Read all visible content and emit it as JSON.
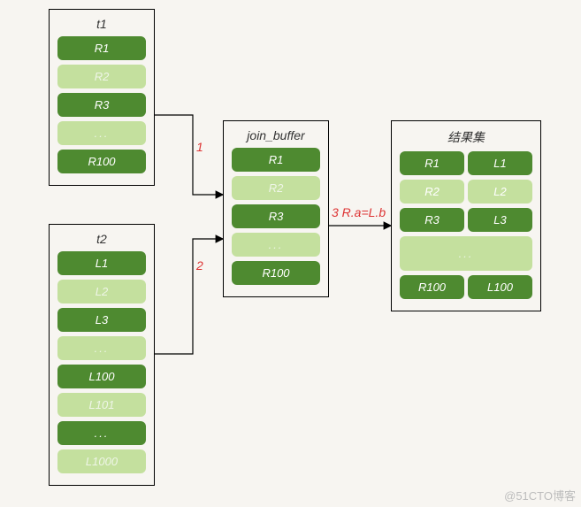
{
  "t1": {
    "title": "t1",
    "rows": [
      {
        "label": "R1",
        "shade": "dark"
      },
      {
        "label": "R2",
        "shade": "light"
      },
      {
        "label": "R3",
        "shade": "dark"
      },
      {
        "label": "...",
        "shade": "light"
      },
      {
        "label": "R100",
        "shade": "dark"
      }
    ]
  },
  "t2": {
    "title": "t2",
    "rows": [
      {
        "label": "L1",
        "shade": "dark"
      },
      {
        "label": "L2",
        "shade": "light"
      },
      {
        "label": "L3",
        "shade": "dark"
      },
      {
        "label": "...",
        "shade": "light"
      },
      {
        "label": "L100",
        "shade": "dark"
      },
      {
        "label": "L101",
        "shade": "light"
      },
      {
        "label": "...",
        "shade": "dark"
      },
      {
        "label": "L1000",
        "shade": "light"
      }
    ]
  },
  "join_buffer": {
    "title": "join_buffer",
    "rows": [
      {
        "label": "R1",
        "shade": "dark"
      },
      {
        "label": "R2",
        "shade": "light"
      },
      {
        "label": "R3",
        "shade": "dark"
      },
      {
        "label": "...",
        "shade": "light"
      },
      {
        "label": "R100",
        "shade": "dark"
      }
    ]
  },
  "result": {
    "title": "结果集",
    "pairs": [
      {
        "l": "R1",
        "r": "L1",
        "shade": "dark"
      },
      {
        "l": "R2",
        "r": "L2",
        "shade": "light"
      },
      {
        "l": "R3",
        "r": "L3",
        "shade": "dark"
      }
    ],
    "mid_ellipsis": "...",
    "last_pair": {
      "l": "R100",
      "r": "L100",
      "shade": "dark"
    }
  },
  "labels": {
    "one": "1",
    "two": "2",
    "cond": "3 R.a=L.b"
  },
  "watermark": "@51CTO博客"
}
